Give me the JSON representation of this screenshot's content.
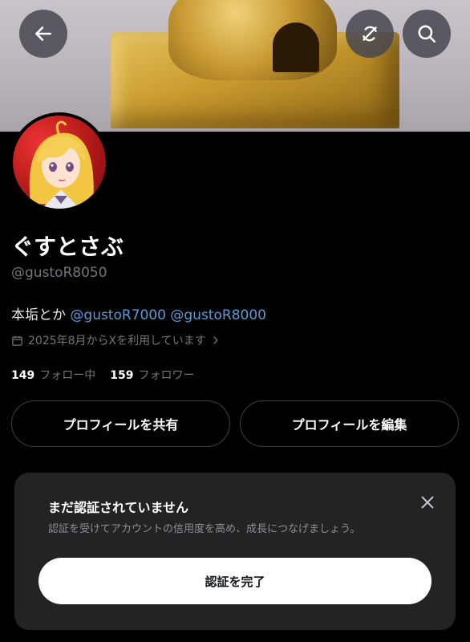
{
  "header": {
    "back_icon": "arrow-left-icon",
    "translate_icon": "no-sync-icon",
    "search_icon": "search-icon"
  },
  "profile": {
    "display_name": "ぐすとさぶ",
    "handle": "@gustoR8050",
    "bio_text": "本垢とか",
    "bio_links": [
      "@gustoR7000",
      "@gustoR8000"
    ],
    "joined": "2025年8月からXを利用しています",
    "following_count": "149",
    "following_label": "フォロー中",
    "followers_count": "159",
    "followers_label": "フォロワー"
  },
  "actions": {
    "share_label": "プロフィールを共有",
    "edit_label": "プロフィールを編集"
  },
  "verification_card": {
    "title": "まだ認証されていません",
    "subtitle": "認証を受けてアカウントの信用度を高め、成長につなげましょう。",
    "cta_label": "認証を完了"
  },
  "colors": {
    "background": "#000000",
    "link": "#5b9bd5",
    "muted": "#71767b",
    "card": "#232325"
  }
}
